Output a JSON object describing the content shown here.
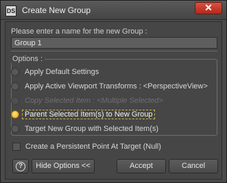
{
  "window": {
    "logo_text": "DS",
    "title": "Create New Group",
    "close_glyph": "✕"
  },
  "prompt": {
    "label": "Please enter a name for the new Group :",
    "value": "Group 1"
  },
  "options": {
    "label": "Options :",
    "items": [
      {
        "label": "Apply Default Settings",
        "selected": false,
        "enabled": true
      },
      {
        "label": "Apply Active Viewport Transforms : <PerspectiveView>",
        "selected": false,
        "enabled": true
      },
      {
        "label": "Copy Selected Item : <Multiple Selected>",
        "selected": false,
        "enabled": false
      },
      {
        "label": "Parent Selected Item(s) to New Group",
        "selected": true,
        "enabled": true
      },
      {
        "label": "Target New Group with Selected Item(s)",
        "selected": false,
        "enabled": true
      }
    ]
  },
  "checkbox": {
    "label": "Create a Persistent Point At Target (Null)",
    "checked": false
  },
  "buttons": {
    "help": "?",
    "hide_options": "Hide Options <<",
    "accept": "Accept",
    "cancel": "Cancel"
  },
  "colors": {
    "selected_radio": "#f0b92c",
    "focus_outline": "#d9b63a",
    "close_button": "#c43a26"
  }
}
